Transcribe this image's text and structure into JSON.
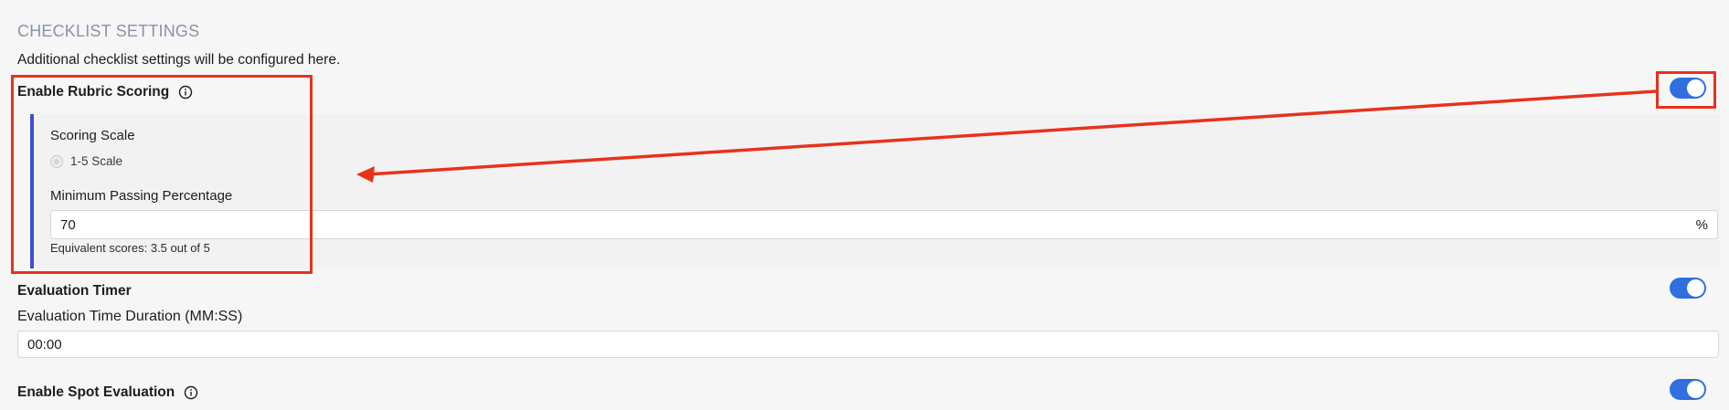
{
  "section": {
    "title": "CHECKLIST SETTINGS",
    "description": "Additional checklist settings will be configured here."
  },
  "rubric": {
    "label": "Enable Rubric Scoring",
    "enabled": true,
    "scoring_scale_label": "Scoring Scale",
    "scale_option": "1-5 Scale",
    "min_passing_label": "Minimum Passing Percentage",
    "min_passing_value": "70",
    "min_passing_suffix": "%",
    "equivalent_hint": "Equivalent scores: 3.5 out of 5"
  },
  "timer": {
    "label": "Evaluation Timer",
    "enabled": true,
    "duration_label": "Evaluation Time Duration (MM:SS)",
    "duration_value": "00:00"
  },
  "spot": {
    "label": "Enable Spot Evaluation",
    "enabled": true
  },
  "colors": {
    "toggle_on": "#2f6fe0",
    "annotation": "#e8321c",
    "sub_bar": "#3a4fd8",
    "section_title": "#8a93a6"
  },
  "icons": {
    "info": "info-icon"
  }
}
